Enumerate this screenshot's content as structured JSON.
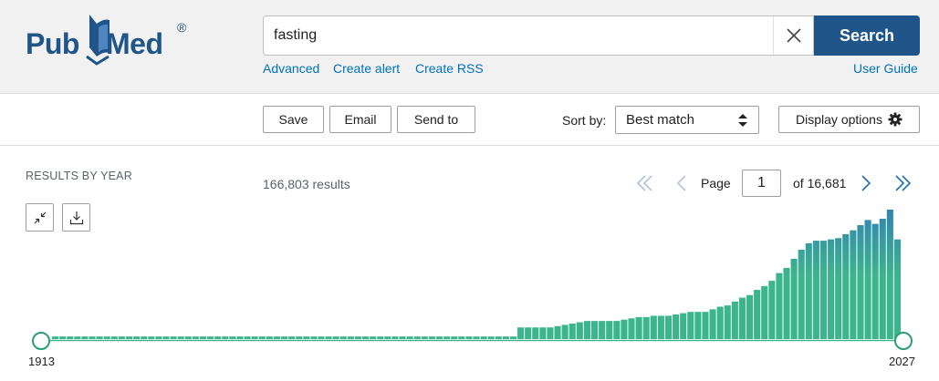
{
  "header": {
    "logo": {
      "part1": "Pub",
      "part2": "Med",
      "registered": "®"
    },
    "search": {
      "value": "fasting",
      "placeholder": "",
      "button_label": "Search"
    },
    "links": {
      "advanced": "Advanced",
      "create_alert": "Create alert",
      "create_rss": "Create RSS",
      "user_guide": "User Guide"
    }
  },
  "toolbar": {
    "save_label": "Save",
    "email_label": "Email",
    "send_to_label": "Send to",
    "sort_by_label": "Sort by:",
    "sort_value": "Best match",
    "display_options_label": "Display options"
  },
  "results": {
    "by_year_title": "RESULTS BY YEAR",
    "count_text": "166,803 results",
    "pagination": {
      "page_label": "Page",
      "current_page": "1",
      "of_text": "of 16,681"
    }
  },
  "histogram": {
    "start_year_label": "1913",
    "end_year_label": "2027",
    "colors": {
      "bar_top": "#2f7eb6",
      "bar_bottom": "#3bb58c",
      "baseline": "#3bb58c",
      "handle_fill": "#ffffff",
      "handle_stroke": "#2e9e7a"
    },
    "bar_heights_relative": [
      0.02,
      0.02,
      0.02,
      0.02,
      0.02,
      0.02,
      0.02,
      0.02,
      0.02,
      0.02,
      0.02,
      0.02,
      0.02,
      0.02,
      0.02,
      0.02,
      0.02,
      0.02,
      0.02,
      0.02,
      0.02,
      0.02,
      0.02,
      0.02,
      0.02,
      0.02,
      0.02,
      0.02,
      0.02,
      0.02,
      0.02,
      0.02,
      0.02,
      0.02,
      0.02,
      0.02,
      0.02,
      0.02,
      0.02,
      0.02,
      0.02,
      0.02,
      0.02,
      0.02,
      0.02,
      0.02,
      0.02,
      0.02,
      0.02,
      0.02,
      0.02,
      0.02,
      0.02,
      0.02,
      0.02,
      0.02,
      0.02,
      0.02,
      0.02,
      0.02,
      0.02,
      0.02,
      0.02,
      0.09,
      0.09,
      0.09,
      0.09,
      0.09,
      0.1,
      0.11,
      0.12,
      0.13,
      0.14,
      0.14,
      0.14,
      0.14,
      0.14,
      0.15,
      0.16,
      0.17,
      0.17,
      0.18,
      0.18,
      0.18,
      0.19,
      0.2,
      0.21,
      0.21,
      0.21,
      0.23,
      0.25,
      0.26,
      0.29,
      0.32,
      0.34,
      0.38,
      0.41,
      0.45,
      0.51,
      0.55,
      0.62,
      0.69,
      0.74,
      0.76,
      0.76,
      0.77,
      0.78,
      0.81,
      0.84,
      0.88,
      0.92,
      0.89,
      0.93,
      1.0,
      0.77
    ]
  }
}
